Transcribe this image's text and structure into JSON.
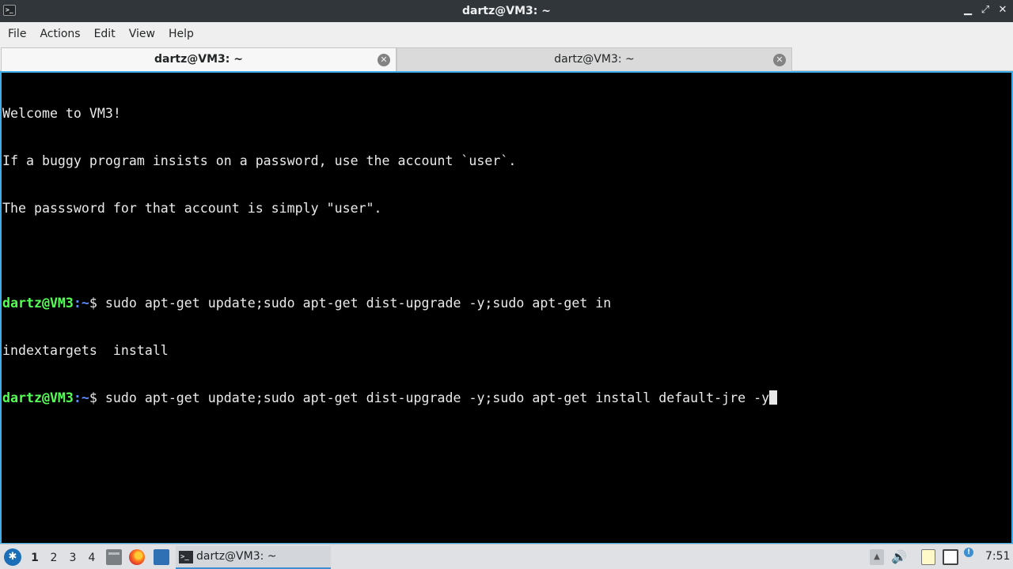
{
  "window": {
    "title": "dartz@VM3: ~",
    "icon": "terminal-icon",
    "buttons": [
      "minimize-icon",
      "maximize-icon",
      "close-icon"
    ]
  },
  "menu": {
    "file": "File",
    "actions": "Actions",
    "edit": "Edit",
    "view": "View",
    "help": "Help"
  },
  "tabs": [
    {
      "label": "dartz@VM3: ~",
      "active": true
    },
    {
      "label": "dartz@VM3: ~",
      "active": false
    }
  ],
  "terminal": {
    "welcome": "Welcome to VM3!",
    "hint1": "If a buggy program insists on a password, use the account `user`.",
    "hint2": "The passsword for that account is simply \"user\".",
    "prompt_user": "dartz@VM3",
    "prompt_path": ":~",
    "prompt_symbol": "$",
    "cmd1": " sudo apt-get update;sudo apt-get dist-upgrade -y;sudo apt-get in",
    "completions": "indextargets  install",
    "cmd2": " sudo apt-get update;sudo apt-get dist-upgrade -y;sudo apt-get install default-jre -y"
  },
  "taskbar": {
    "desktops": [
      "1",
      "2",
      "3",
      "4"
    ],
    "active_desktop": "1",
    "task_label": "dartz@VM3: ~",
    "clock": "7:51"
  },
  "colors": {
    "accent": "#3daee9",
    "prompt_user": "#55ff55",
    "prompt_path": "#5c8dff"
  }
}
